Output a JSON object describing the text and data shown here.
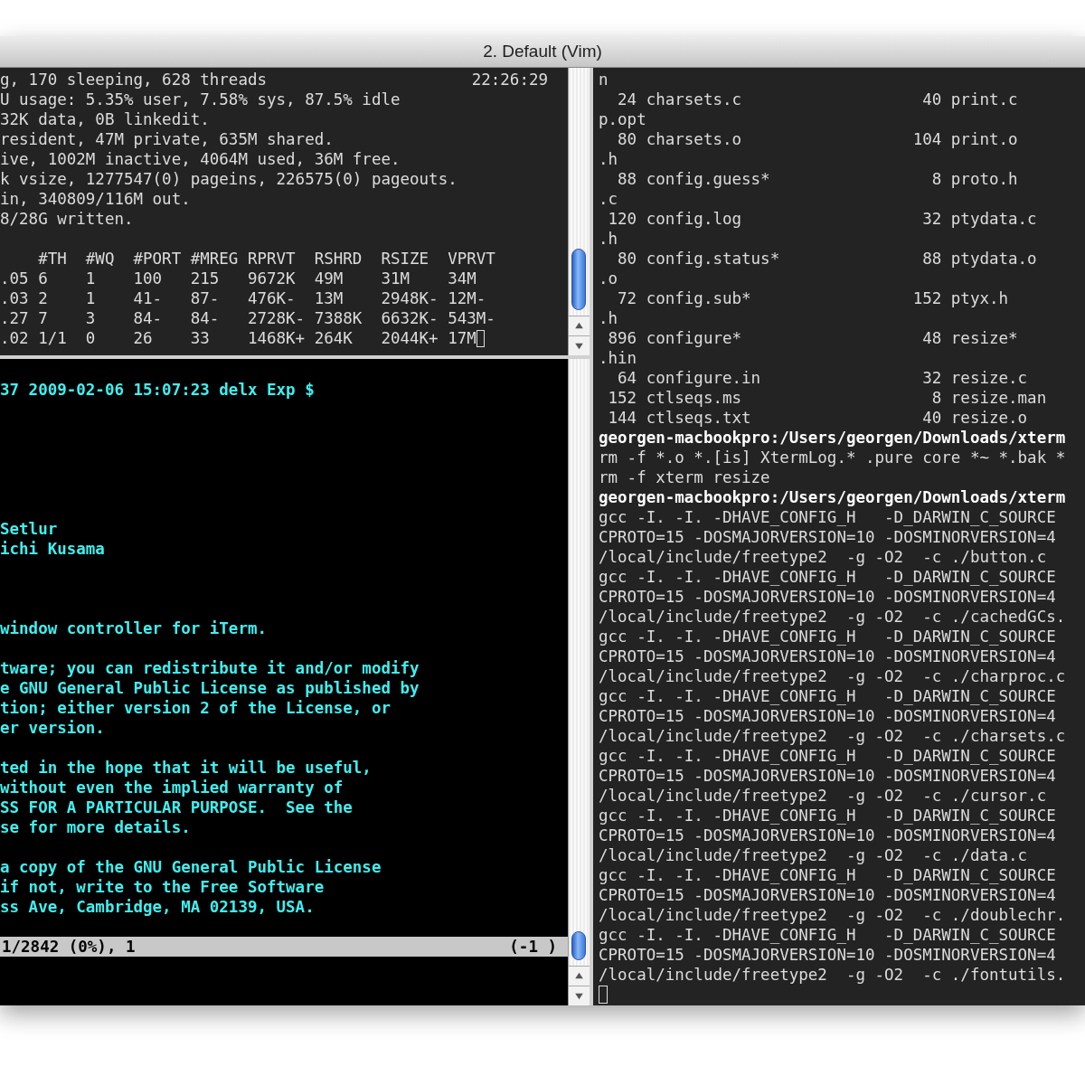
{
  "window": {
    "title": "2. Default (Vim)"
  },
  "top_pane": {
    "clock": "22:26:29",
    "lines": [
      "g, 170 sleeping, 628 threads",
      "U usage: 5.35% user, 7.58% sys, 87.5% idle",
      "32K data, 0B linkedit.",
      "resident, 47M private, 635M shared.",
      "ive, 1002M inactive, 4064M used, 36M free.",
      "k vsize, 1277547(0) pageins, 226575(0) pageouts.",
      "in, 340809/116M out.",
      "8/28G written."
    ],
    "table": {
      "columns": [
        "",
        "#TH",
        "#WQ",
        "#PORT",
        "#MREG",
        "RPRVT",
        "RSHRD",
        "RSIZE",
        "VPRVT"
      ],
      "rows": [
        [
          ".05",
          "6",
          "1",
          "100",
          "215",
          "9672K",
          "49M",
          "31M",
          "34M"
        ],
        [
          ".03",
          "2",
          "1",
          "41-",
          "87-",
          "476K-",
          "13M",
          "2948K-",
          "12M-"
        ],
        [
          ".27",
          "7",
          "3",
          "84-",
          "84-",
          "2728K-",
          "7388K",
          "6632K-",
          "543M-"
        ],
        [
          ".02",
          "1/1",
          "0",
          "26",
          "33",
          "1468K+",
          "264K",
          "2044K+",
          "17M"
        ]
      ]
    }
  },
  "vim_pane": {
    "paragraphs": [
      [
        "37 2009-02-06 15:07:23 delx Exp $"
      ],
      [
        "Setlur",
        "ichi Kusama"
      ],
      [
        "window controller for iTerm."
      ],
      [
        "tware; you can redistribute it and/or modify",
        "e GNU General Public License as published by",
        "tion; either version 2 of the License, or",
        "er version."
      ],
      [
        "ted in the hope that it will be useful,",
        "without even the implied warranty of",
        "SS FOR A PARTICULAR PURPOSE.  See the",
        "se for more details."
      ],
      [
        "a copy of the GNU General Public License",
        "if not, write to the Free Software",
        "ss Ave, Cambridge, MA 02139, USA."
      ]
    ],
    "status_line": {
      "position": "1/2842 (0%), 1",
      "right": "(-1 )"
    }
  },
  "shell_pane": {
    "lines": [
      {
        "kind": "text",
        "text": "n"
      },
      {
        "kind": "listing",
        "size": "24",
        "name": "charsets.c",
        "size_2": "40",
        "name_2": "print.c"
      },
      {
        "kind": "text",
        "text": "p.opt"
      },
      {
        "kind": "listing",
        "size": "80",
        "name": "charsets.o",
        "size_2": "104",
        "name_2": "print.o"
      },
      {
        "kind": "text",
        "text": ".h"
      },
      {
        "kind": "listing",
        "size": "88",
        "name": "config.guess*",
        "size_2": "8",
        "name_2": "proto.h"
      },
      {
        "kind": "text",
        "text": ".c"
      },
      {
        "kind": "listing",
        "size": "120",
        "name": "config.log",
        "size_2": "32",
        "name_2": "ptydata.c"
      },
      {
        "kind": "text",
        "text": ".h"
      },
      {
        "kind": "listing",
        "size": "80",
        "name": "config.status*",
        "size_2": "88",
        "name_2": "ptydata.o"
      },
      {
        "kind": "text",
        "text": ".o"
      },
      {
        "kind": "listing",
        "size": "72",
        "name": "config.sub*",
        "size_2": "152",
        "name_2": "ptyx.h"
      },
      {
        "kind": "text",
        "text": ".h"
      },
      {
        "kind": "listing",
        "size": "896",
        "name": "configure*",
        "size_2": "48",
        "name_2": "resize*"
      },
      {
        "kind": "text",
        "text": ".hin"
      },
      {
        "kind": "listing",
        "size": "64",
        "name": "configure.in",
        "size_2": "32",
        "name_2": "resize.c"
      },
      {
        "kind": "listing",
        "size": "152",
        "name": "ctlseqs.ms",
        "size_2": "8",
        "name_2": "resize.man"
      },
      {
        "kind": "listing",
        "size": "144",
        "name": "ctlseqs.txt",
        "size_2": "40",
        "name_2": "resize.o"
      },
      {
        "kind": "prompt",
        "text": "georgen-macbookpro:/Users/georgen/Downloads/xterm"
      },
      {
        "kind": "text",
        "text": "rm -f *.o *.[is] XtermLog.* .pure core *~ *.bak *"
      },
      {
        "kind": "text",
        "text": "rm -f xterm resize"
      },
      {
        "kind": "prompt",
        "text": "georgen-macbookpro:/Users/georgen/Downloads/xterm"
      },
      {
        "kind": "text",
        "text": "gcc -I. -I. -DHAVE_CONFIG_H   -D_DARWIN_C_SOURCE"
      },
      {
        "kind": "text",
        "text": "CPROTO=15 -DOSMAJORVERSION=10 -DOSMINORVERSION=4"
      },
      {
        "kind": "text",
        "text": "/local/include/freetype2  -g -O2  -c ./button.c"
      },
      {
        "kind": "text",
        "text": "gcc -I. -I. -DHAVE_CONFIG_H   -D_DARWIN_C_SOURCE"
      },
      {
        "kind": "text",
        "text": "CPROTO=15 -DOSMAJORVERSION=10 -DOSMINORVERSION=4"
      },
      {
        "kind": "text",
        "text": "/local/include/freetype2  -g -O2  -c ./cachedGCs."
      },
      {
        "kind": "text",
        "text": "gcc -I. -I. -DHAVE_CONFIG_H   -D_DARWIN_C_SOURCE"
      },
      {
        "kind": "text",
        "text": "CPROTO=15 -DOSMAJORVERSION=10 -DOSMINORVERSION=4"
      },
      {
        "kind": "text",
        "text": "/local/include/freetype2  -g -O2  -c ./charproc.c"
      },
      {
        "kind": "text",
        "text": "gcc -I. -I. -DHAVE_CONFIG_H   -D_DARWIN_C_SOURCE"
      },
      {
        "kind": "text",
        "text": "CPROTO=15 -DOSMAJORVERSION=10 -DOSMINORVERSION=4"
      },
      {
        "kind": "text",
        "text": "/local/include/freetype2  -g -O2  -c ./charsets.c"
      },
      {
        "kind": "text",
        "text": "gcc -I. -I. -DHAVE_CONFIG_H   -D_DARWIN_C_SOURCE"
      },
      {
        "kind": "text",
        "text": "CPROTO=15 -DOSMAJORVERSION=10 -DOSMINORVERSION=4"
      },
      {
        "kind": "text",
        "text": "/local/include/freetype2  -g -O2  -c ./cursor.c"
      },
      {
        "kind": "text",
        "text": "gcc -I. -I. -DHAVE_CONFIG_H   -D_DARWIN_C_SOURCE"
      },
      {
        "kind": "text",
        "text": "CPROTO=15 -DOSMAJORVERSION=10 -DOSMINORVERSION=4"
      },
      {
        "kind": "text",
        "text": "/local/include/freetype2  -g -O2  -c ./data.c"
      },
      {
        "kind": "text",
        "text": "gcc -I. -I. -DHAVE_CONFIG_H   -D_DARWIN_C_SOURCE"
      },
      {
        "kind": "text",
        "text": "CPROTO=15 -DOSMAJORVERSION=10 -DOSMINORVERSION=4"
      },
      {
        "kind": "text",
        "text": "/local/include/freetype2  -g -O2  -c ./doublechr."
      },
      {
        "kind": "text",
        "text": "gcc -I. -I. -DHAVE_CONFIG_H   -D_DARWIN_C_SOURCE"
      },
      {
        "kind": "text",
        "text": "CPROTO=15 -DOSMAJORVERSION=10 -DOSMINORVERSION=4"
      },
      {
        "kind": "text",
        "text": "/local/include/freetype2  -g -O2  -c ./fontutils."
      }
    ]
  }
}
